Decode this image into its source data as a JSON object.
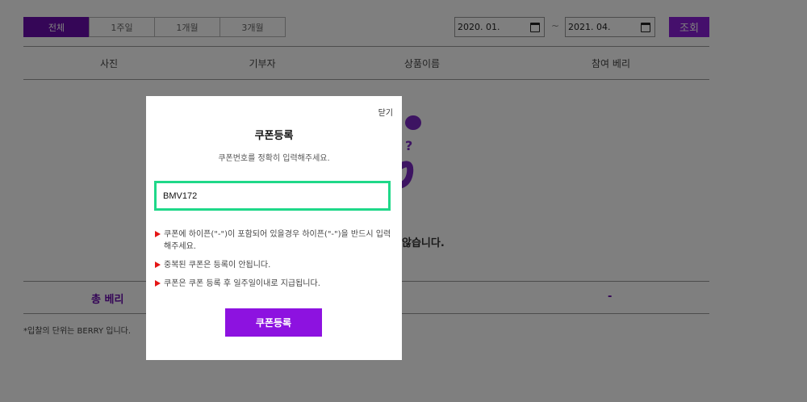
{
  "filters": {
    "tabs": [
      {
        "label": "전체",
        "active": true
      },
      {
        "label": "1주일",
        "active": false
      },
      {
        "label": "1개월",
        "active": false
      },
      {
        "label": "3개월",
        "active": false
      }
    ],
    "date_from": "2020. 01. ",
    "date_to": "2021. 04. ",
    "range_separator": "~",
    "search_label": "조회"
  },
  "table": {
    "columns": [
      "사진",
      "기부자",
      "상품이름",
      "참여 베리"
    ],
    "empty_message": "않습니다."
  },
  "summary": {
    "total_label": "총 베리",
    "total_value": "-"
  },
  "footnote": "*입찰의 단위는 BERRY 입니다.",
  "modal": {
    "close_label": "닫기",
    "title": "쿠폰등록",
    "subtitle": "쿠폰번호를 정확히 입력해주세요.",
    "input_value": "BMV172",
    "notes": [
      "쿠폰에 하이픈(\"-\")이 포함되어 있을경우 하이픈(\"-\")을 반드시 입력해주세요.",
      "중복된 쿠폰은 등록이 안됩니다.",
      "쿠폰은 쿠폰 등록 후 일주일이내로 지급됩니다."
    ],
    "submit_label": "쿠폰등록"
  },
  "colors": {
    "brand_purple": "#6a0cae",
    "button_purple": "#8d12e0",
    "input_focus": "#1fd889",
    "note_marker": "#e51515"
  }
}
